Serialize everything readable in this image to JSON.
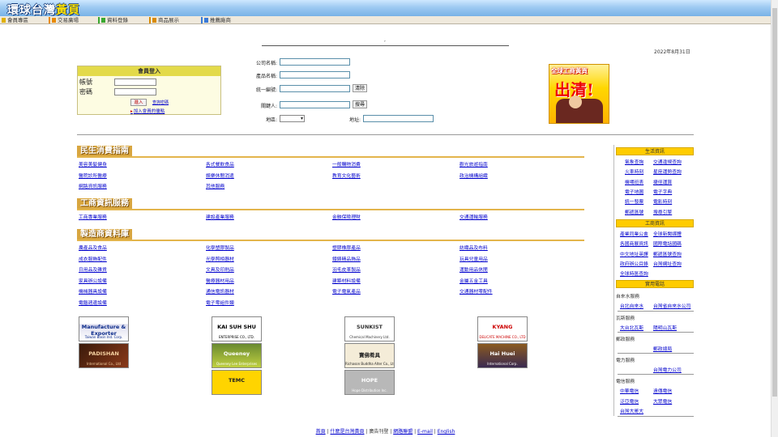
{
  "banner": {
    "logo_part1": "環球台灣",
    "logo_part2": "黃頁"
  },
  "nav": [
    {
      "label": "會員專區",
      "color": "#e0b000"
    },
    {
      "label": "交易廣場",
      "color": "#e88a00"
    },
    {
      "label": "資料登錄",
      "color": "#3aa830"
    },
    {
      "label": "商品展示",
      "color": "#d88a00"
    },
    {
      "label": "推薦廠商",
      "color": "#3a7ad8"
    }
  ],
  "header": {
    "dot": ",",
    "date": "2022年8月31日"
  },
  "login": {
    "title": "會員登入",
    "account_label": "帳號",
    "password_label": "密碼",
    "login_button": "進入",
    "forgot_link": "查詢密碼",
    "join_link": "加入會員的優點"
  },
  "search": {
    "company_label": "公司名稱:",
    "product_label": "產品名稱:",
    "tax_label": "統一編號:",
    "clear_button": "清除",
    "keyword_label": "關鍵人:",
    "search_button": "搜尋",
    "region_label": "地區:",
    "address_label": "地址:"
  },
  "ad": {
    "top_text": "全球工商黃頁",
    "main_text": "出清!"
  },
  "sections": {
    "consumer": {
      "title": "民生消費指南",
      "links": [
        "美容美髮健身",
        "各式餐飲食品",
        "一般購物消費",
        "觀光旅遊指南",
        "醫院診所醫療",
        "娛樂休閒消遣",
        "教育文化藝術",
        "政治機構組織",
        "網路資訊服務",
        "其他服務"
      ]
    },
    "business": {
      "title": "工商資訊服務",
      "links": [
        "工商專業服務",
        "建設產業服務",
        "金融保險理財",
        "交通運輸服務"
      ]
    },
    "manufacturing": {
      "title": "製造商資料庫",
      "links": [
        "農產品及食品",
        "化學塑膠製品",
        "塑膠橡膠產品",
        "紡織品及布料",
        "成衣服飾配件",
        "光學照相器材",
        "鐘錶精品飾品",
        "玩具兒童用品",
        "日用品及雜貨",
        "文具及印刷品",
        "羽毛皮革製品",
        "運動用品休閒",
        "家具辦公設備",
        "醫療器材用品",
        "建築材料設備",
        "金屬五金工具",
        "機械器具設備",
        "通信電訊器材",
        "電子電氣產品",
        "交通器材零配件",
        "電腦週邊設備",
        "電子零組件類"
      ]
    }
  },
  "company_logos": [
    {
      "top": "Manufacture & Exporter",
      "bottom": "Taiwan Basin Ind. Corp."
    },
    {
      "top": "KAI SUH SHU",
      "bottom": "ENTERPRISE CO., LTD."
    },
    {
      "top": "SUNKIST",
      "bottom": "Chemical Machinery Ltd."
    },
    {
      "top": "KYANG",
      "bottom": "DELICATE MACHINE CO., LTD"
    },
    {
      "top": "PADISHAN",
      "bottom": "International Co., Ltd"
    },
    {
      "top": "Queeney",
      "bottom": "Queeney Lee Enterprises"
    },
    {
      "top": "寶佛肴具",
      "bottom": "Richason Buddha Alter Co., Ltd."
    },
    {
      "top": "Hai Huei",
      "bottom": "International Corp."
    },
    {
      "top": "TEMC",
      "bottom": ""
    },
    {
      "top": "HOPE",
      "bottom": "Hope Distribution Inc."
    }
  ],
  "right_panel": {
    "life_title": "生活資訊",
    "life_links": [
      "氣象查詢",
      "交通違規查詢",
      "火車時刻",
      "星座運勢查詢",
      "機場班表",
      "捷徑運算",
      "電子地圖",
      "電子字典",
      "統一發票",
      "電影時刻",
      "郵遞區號",
      "搜尋引擎"
    ],
    "biz_title": "工商資訊",
    "biz_links": [
      "產業同業公會",
      "全球新聞媒體",
      "各國商展資訊",
      "國際電話國碼",
      "中文地址英譯",
      "郵遞區號查詢",
      "政府辦公目錄",
      "台灣網址查詢",
      "全球時區查詢"
    ],
    "util_title": "實用電話",
    "water_title": "自來水服務",
    "water_links": [
      "台北自來水",
      "台灣省自來水公司"
    ],
    "gas_title": "瓦斯服務",
    "gas_links": [
      "大台北瓦斯",
      "陽明山瓦斯"
    ],
    "post_title": "郵政服務",
    "post_links": [
      "郵政總局"
    ],
    "power_title": "電力服務",
    "power_links": [
      "台灣電力公司"
    ],
    "tele_title": "電信服務",
    "tele_links": [
      "中華電信",
      "遠傳電信",
      "泛亞電信",
      "大眾電信",
      "台灣大哥大"
    ]
  },
  "footer": {
    "home": "首頁",
    "what": "什麼是台灣黃頁",
    "ads": "廣告刊登",
    "links": "網路聯盟",
    "email": "E-mail",
    "english": "English"
  }
}
